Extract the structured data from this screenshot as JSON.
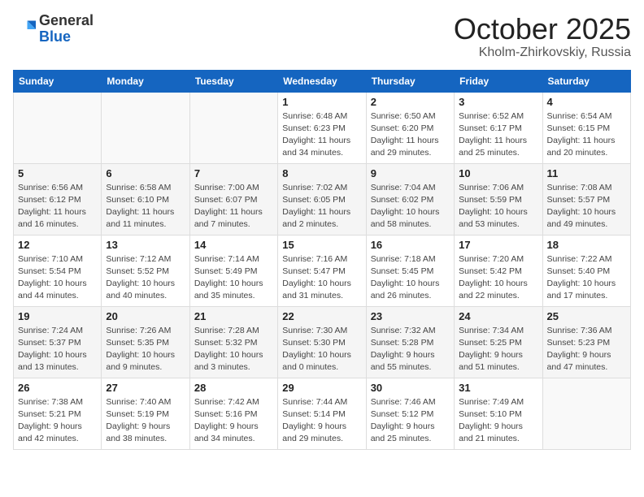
{
  "header": {
    "logo_general": "General",
    "logo_blue": "Blue",
    "month_title": "October 2025",
    "location": "Kholm-Zhirkovskiy, Russia"
  },
  "weekdays": [
    "Sunday",
    "Monday",
    "Tuesday",
    "Wednesday",
    "Thursday",
    "Friday",
    "Saturday"
  ],
  "weeks": [
    [
      {
        "day": "",
        "info": ""
      },
      {
        "day": "",
        "info": ""
      },
      {
        "day": "",
        "info": ""
      },
      {
        "day": "1",
        "info": "Sunrise: 6:48 AM\nSunset: 6:23 PM\nDaylight: 11 hours\nand 34 minutes."
      },
      {
        "day": "2",
        "info": "Sunrise: 6:50 AM\nSunset: 6:20 PM\nDaylight: 11 hours\nand 29 minutes."
      },
      {
        "day": "3",
        "info": "Sunrise: 6:52 AM\nSunset: 6:17 PM\nDaylight: 11 hours\nand 25 minutes."
      },
      {
        "day": "4",
        "info": "Sunrise: 6:54 AM\nSunset: 6:15 PM\nDaylight: 11 hours\nand 20 minutes."
      }
    ],
    [
      {
        "day": "5",
        "info": "Sunrise: 6:56 AM\nSunset: 6:12 PM\nDaylight: 11 hours\nand 16 minutes."
      },
      {
        "day": "6",
        "info": "Sunrise: 6:58 AM\nSunset: 6:10 PM\nDaylight: 11 hours\nand 11 minutes."
      },
      {
        "day": "7",
        "info": "Sunrise: 7:00 AM\nSunset: 6:07 PM\nDaylight: 11 hours\nand 7 minutes."
      },
      {
        "day": "8",
        "info": "Sunrise: 7:02 AM\nSunset: 6:05 PM\nDaylight: 11 hours\nand 2 minutes."
      },
      {
        "day": "9",
        "info": "Sunrise: 7:04 AM\nSunset: 6:02 PM\nDaylight: 10 hours\nand 58 minutes."
      },
      {
        "day": "10",
        "info": "Sunrise: 7:06 AM\nSunset: 5:59 PM\nDaylight: 10 hours\nand 53 minutes."
      },
      {
        "day": "11",
        "info": "Sunrise: 7:08 AM\nSunset: 5:57 PM\nDaylight: 10 hours\nand 49 minutes."
      }
    ],
    [
      {
        "day": "12",
        "info": "Sunrise: 7:10 AM\nSunset: 5:54 PM\nDaylight: 10 hours\nand 44 minutes."
      },
      {
        "day": "13",
        "info": "Sunrise: 7:12 AM\nSunset: 5:52 PM\nDaylight: 10 hours\nand 40 minutes."
      },
      {
        "day": "14",
        "info": "Sunrise: 7:14 AM\nSunset: 5:49 PM\nDaylight: 10 hours\nand 35 minutes."
      },
      {
        "day": "15",
        "info": "Sunrise: 7:16 AM\nSunset: 5:47 PM\nDaylight: 10 hours\nand 31 minutes."
      },
      {
        "day": "16",
        "info": "Sunrise: 7:18 AM\nSunset: 5:45 PM\nDaylight: 10 hours\nand 26 minutes."
      },
      {
        "day": "17",
        "info": "Sunrise: 7:20 AM\nSunset: 5:42 PM\nDaylight: 10 hours\nand 22 minutes."
      },
      {
        "day": "18",
        "info": "Sunrise: 7:22 AM\nSunset: 5:40 PM\nDaylight: 10 hours\nand 17 minutes."
      }
    ],
    [
      {
        "day": "19",
        "info": "Sunrise: 7:24 AM\nSunset: 5:37 PM\nDaylight: 10 hours\nand 13 minutes."
      },
      {
        "day": "20",
        "info": "Sunrise: 7:26 AM\nSunset: 5:35 PM\nDaylight: 10 hours\nand 9 minutes."
      },
      {
        "day": "21",
        "info": "Sunrise: 7:28 AM\nSunset: 5:32 PM\nDaylight: 10 hours\nand 3 minutes."
      },
      {
        "day": "22",
        "info": "Sunrise: 7:30 AM\nSunset: 5:30 PM\nDaylight: 10 hours\nand 0 minutes."
      },
      {
        "day": "23",
        "info": "Sunrise: 7:32 AM\nSunset: 5:28 PM\nDaylight: 9 hours\nand 55 minutes."
      },
      {
        "day": "24",
        "info": "Sunrise: 7:34 AM\nSunset: 5:25 PM\nDaylight: 9 hours\nand 51 minutes."
      },
      {
        "day": "25",
        "info": "Sunrise: 7:36 AM\nSunset: 5:23 PM\nDaylight: 9 hours\nand 47 minutes."
      }
    ],
    [
      {
        "day": "26",
        "info": "Sunrise: 7:38 AM\nSunset: 5:21 PM\nDaylight: 9 hours\nand 42 minutes."
      },
      {
        "day": "27",
        "info": "Sunrise: 7:40 AM\nSunset: 5:19 PM\nDaylight: 9 hours\nand 38 minutes."
      },
      {
        "day": "28",
        "info": "Sunrise: 7:42 AM\nSunset: 5:16 PM\nDaylight: 9 hours\nand 34 minutes."
      },
      {
        "day": "29",
        "info": "Sunrise: 7:44 AM\nSunset: 5:14 PM\nDaylight: 9 hours\nand 29 minutes."
      },
      {
        "day": "30",
        "info": "Sunrise: 7:46 AM\nSunset: 5:12 PM\nDaylight: 9 hours\nand 25 minutes."
      },
      {
        "day": "31",
        "info": "Sunrise: 7:49 AM\nSunset: 5:10 PM\nDaylight: 9 hours\nand 21 minutes."
      },
      {
        "day": "",
        "info": ""
      }
    ]
  ]
}
